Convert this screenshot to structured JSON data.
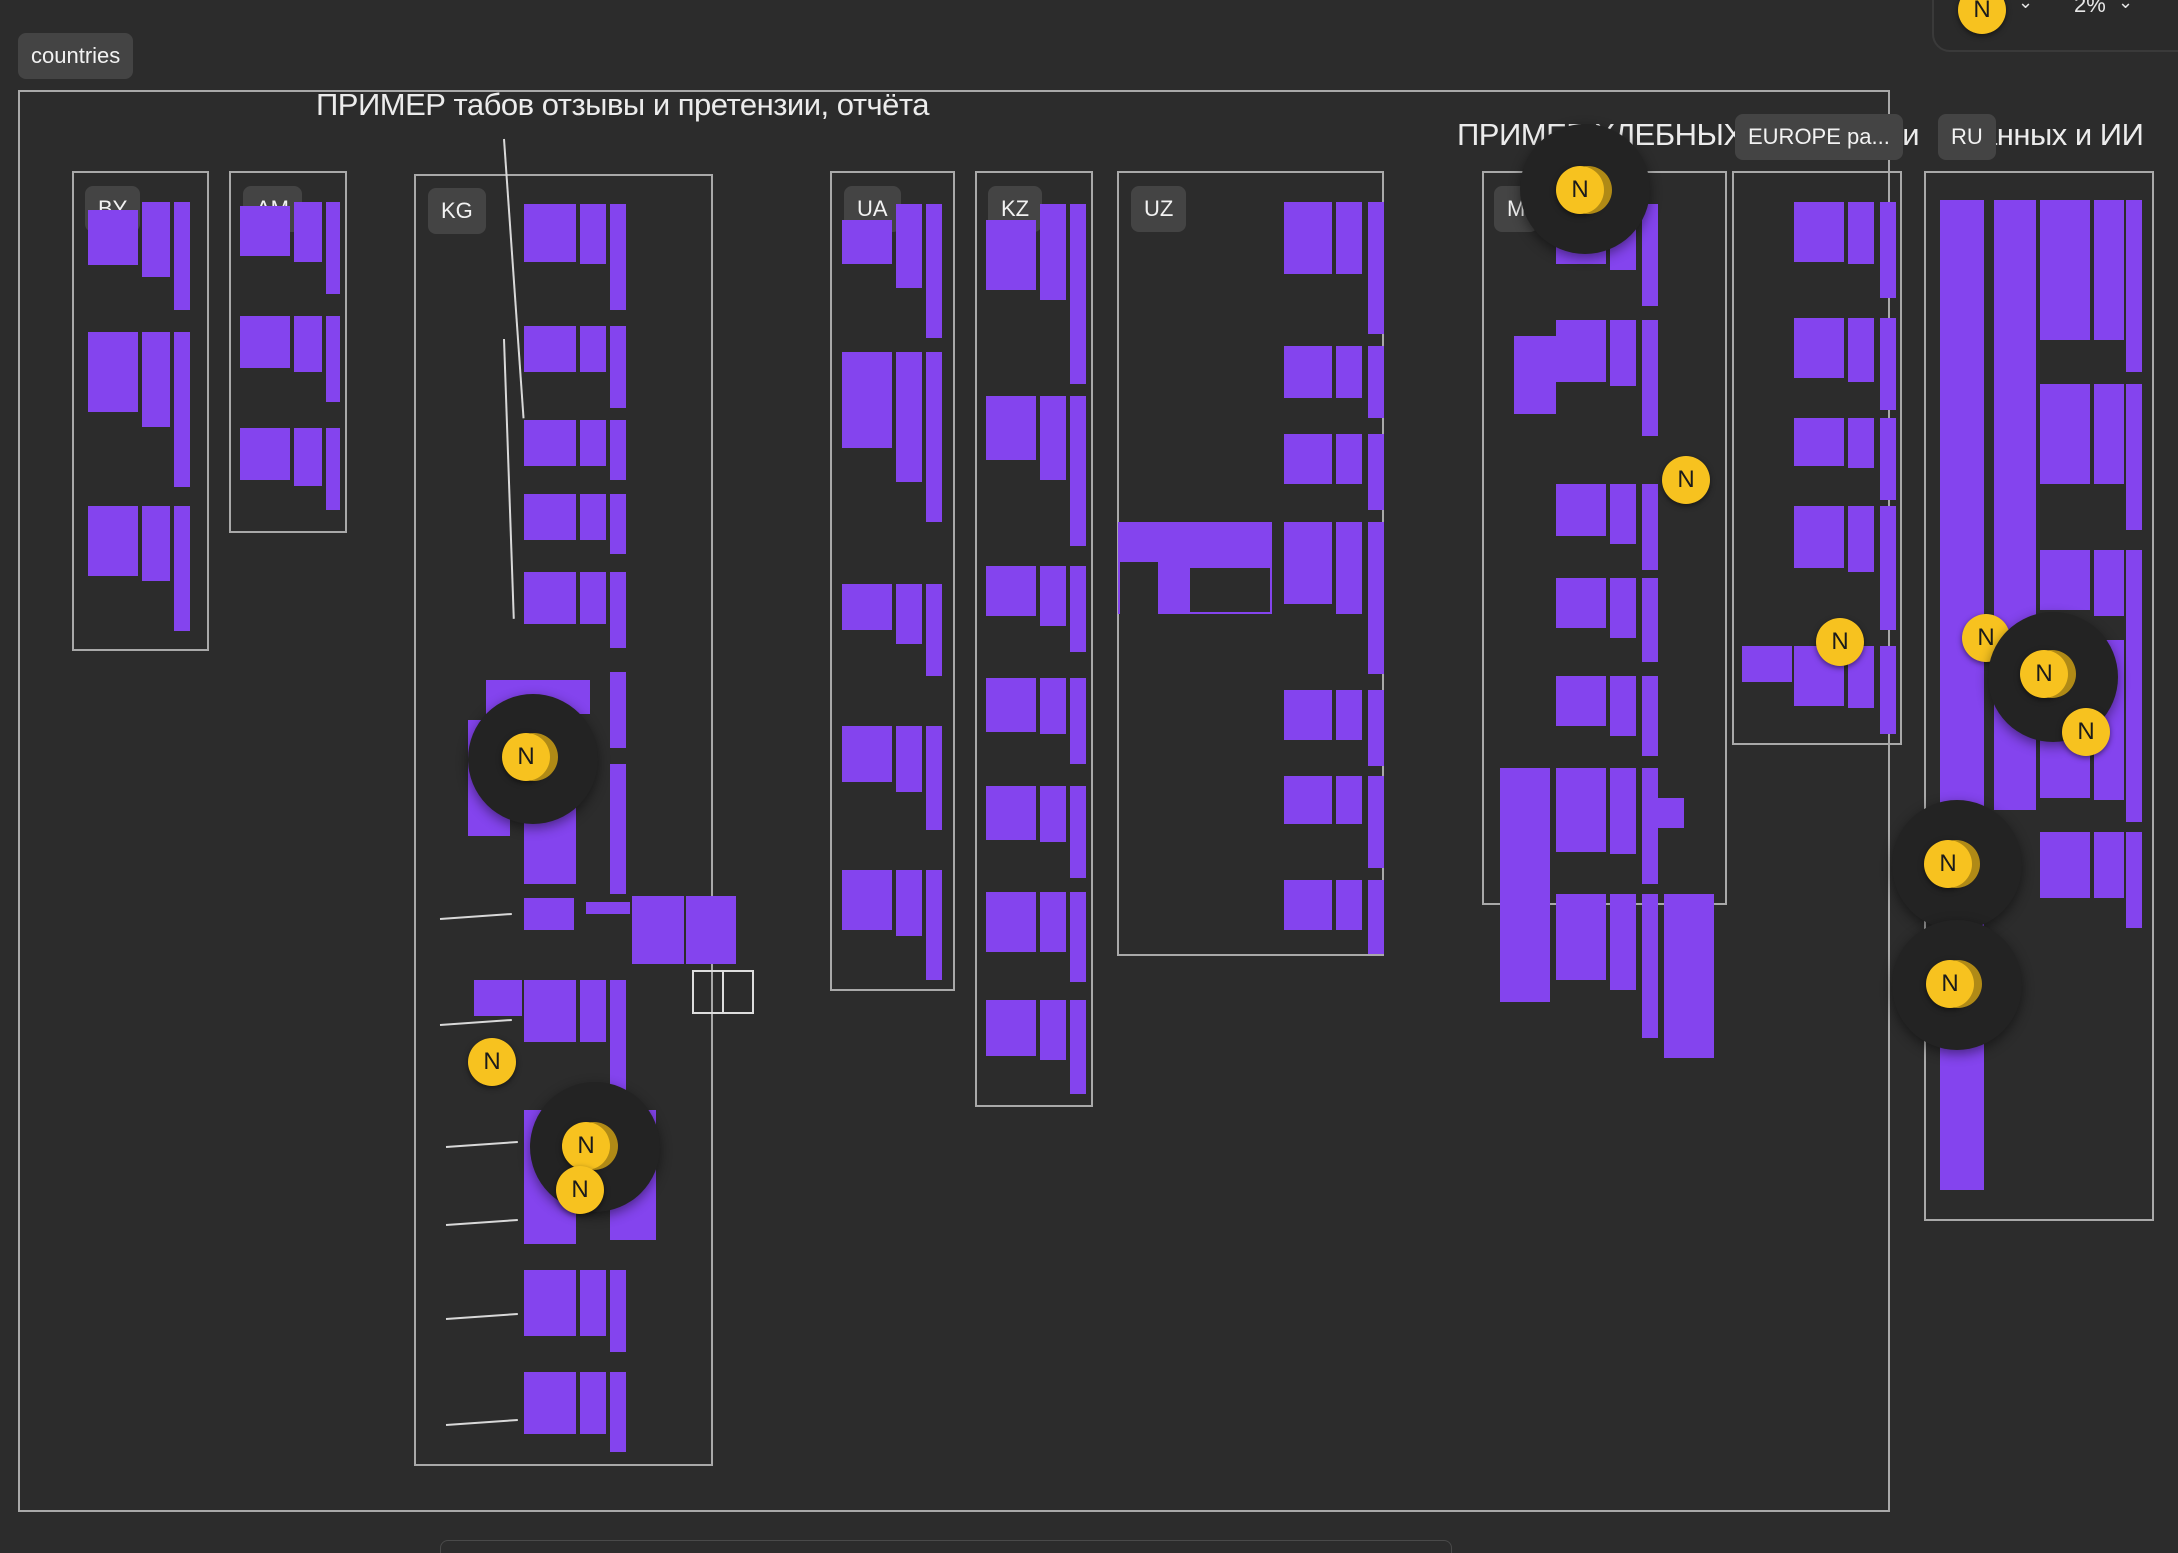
{
  "root_tag": "countries",
  "annotations": {
    "tabs_example": "ПРИМЕР табов отзывы и претензии, отчёта",
    "breadcrumbs_example": "ПРИМЕР ХЛЕБНЫХ",
    "breadcrumbs_example_tail": ", и",
    "breadcrumbs_example_tail2": "анных и ИИ"
  },
  "sections": [
    {
      "id": "by",
      "label": "BY"
    },
    {
      "id": "am",
      "label": "AM"
    },
    {
      "id": "kg",
      "label": "KG"
    },
    {
      "id": "ua",
      "label": "UA"
    },
    {
      "id": "kz",
      "label": "KZ"
    },
    {
      "id": "uz",
      "label": "UZ"
    },
    {
      "id": "md",
      "label": "M"
    },
    {
      "id": "europe",
      "label": "EUROPE pa..."
    },
    {
      "id": "ru",
      "label": "RU"
    }
  ],
  "collaborator_initial": "N",
  "toolbar": {
    "zoom": "2%"
  },
  "colors": {
    "accent": "#8444ee",
    "cursor": "#f7c21f",
    "canvas": "#2c2c2c"
  }
}
